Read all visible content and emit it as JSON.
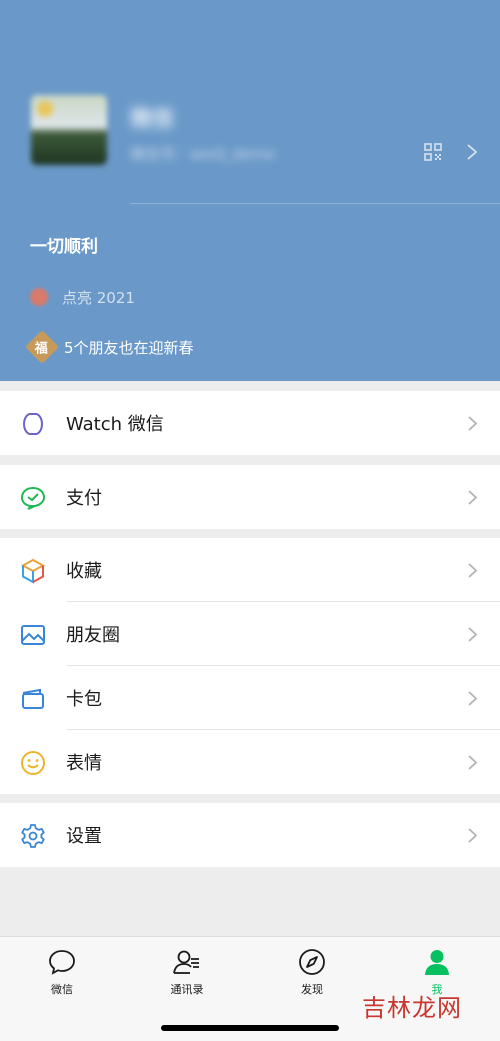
{
  "profile": {
    "nickname": "微信",
    "wechat_id": "微信号：wxid_demo",
    "status_text": "一切顺利",
    "light_up_text": "点亮 2021",
    "friends_text": "5个朋友也在迎新春",
    "fu_badge": "福"
  },
  "groups": {
    "watch": {
      "label": "Watch 微信",
      "icon": "watch-icon"
    },
    "pay": {
      "label": "支付",
      "icon": "wechat-pay-icon"
    },
    "collections": [
      {
        "label": "收藏",
        "icon": "cube-icon"
      },
      {
        "label": "朋友圈",
        "icon": "image-icon"
      },
      {
        "label": "卡包",
        "icon": "card-wallet-icon"
      },
      {
        "label": "表情",
        "icon": "smiley-icon"
      }
    ],
    "settings": {
      "label": "设置",
      "icon": "gear-icon"
    }
  },
  "tabbar": [
    {
      "label": "微信",
      "icon": "chat-bubble-icon",
      "active": false
    },
    {
      "label": "通讯录",
      "icon": "contacts-icon",
      "active": false
    },
    {
      "label": "发现",
      "icon": "compass-icon",
      "active": false
    },
    {
      "label": "我",
      "icon": "person-icon",
      "active": true
    }
  ],
  "colors": {
    "header_bg": "#6a99c9",
    "accent_green": "#07c160",
    "page_bg": "#ededed"
  },
  "watermark": "吉林龙网"
}
